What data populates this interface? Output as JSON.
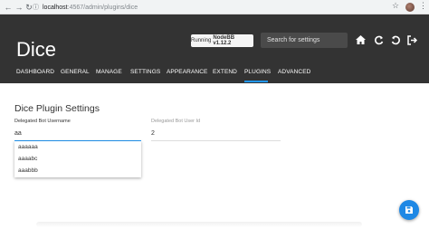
{
  "browser": {
    "url_host": "localhost",
    "url_path": ":4567/admin/plugins/dice"
  },
  "header": {
    "title": "Dice",
    "version_prefix": "Running",
    "version_label": "NodeBB v1.12.2",
    "search_placeholder": "Search for settings",
    "tabs": [
      {
        "label": "DASHBOARD"
      },
      {
        "label": "GENERAL"
      },
      {
        "label": "MANAGE"
      },
      {
        "label": "SETTINGS"
      },
      {
        "label": "APPEARANCE"
      },
      {
        "label": "EXTEND"
      },
      {
        "label": "PLUGINS"
      },
      {
        "label": "ADVANCED"
      }
    ],
    "active_tab": "PLUGINS",
    "accent_color": "#2196f3"
  },
  "settings": {
    "title": "Dice Plugin Settings",
    "username_label": "Delegated Bot Username",
    "username_value": "aa",
    "userid_label": "Delegated Bot User Id",
    "userid_value": "2",
    "suggestions": [
      "aaaaaa",
      "aaaabc",
      "aaabbb"
    ]
  },
  "fab": {
    "icon": "save-icon",
    "color": "#1e88e5"
  }
}
